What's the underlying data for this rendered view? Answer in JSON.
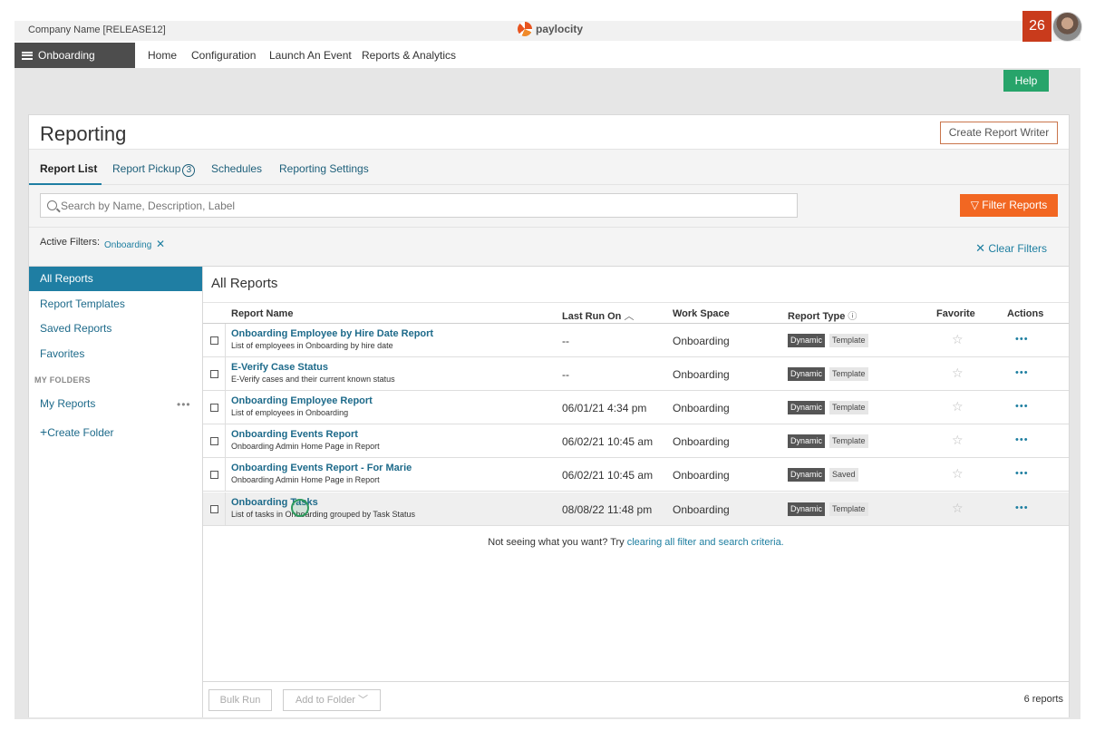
{
  "header": {
    "company": "Company Name [RELEASE12]",
    "brand": "paylocity",
    "notification_count": "26"
  },
  "nav": {
    "menu_label": "Onboarding",
    "links": [
      "Home",
      "Configuration",
      "Launch An Event",
      "Reports & Analytics"
    ]
  },
  "help_label": "Help",
  "page": {
    "title": "Reporting",
    "create_button": "Create Report Writer"
  },
  "tabs": [
    {
      "label": "Report List",
      "active": true
    },
    {
      "label": "Report Pickup",
      "badge": "3"
    },
    {
      "label": "Schedules"
    },
    {
      "label": "Reporting Settings"
    }
  ],
  "search": {
    "placeholder": "Search by Name, Description, Label",
    "value": ""
  },
  "filter_button": "Filter Reports",
  "active_filters": {
    "label": "Active Filters:",
    "chip": "Onboarding",
    "clear": "Clear Filters"
  },
  "sidebar": {
    "items": [
      "All Reports",
      "Report Templates",
      "Saved Reports",
      "Favorites"
    ],
    "section": "MY FOLDERS",
    "folders": [
      "My Reports"
    ],
    "create_folder": "Create Folder"
  },
  "content": {
    "title": "All Reports",
    "columns": [
      "Report Name",
      "Last Run On",
      "Work Space",
      "Report Type",
      "Favorite",
      "Actions"
    ],
    "rows": [
      {
        "name": "Onboarding Employee by Hire Date Report",
        "desc": "List of employees in Onboarding by hire date",
        "last_run": "--",
        "workspace": "Onboarding",
        "type1": "Dynamic",
        "type2": "Template"
      },
      {
        "name": "E-Verify Case Status",
        "desc": "E-Verify cases and their current known status",
        "last_run": "--",
        "workspace": "Onboarding",
        "type1": "Dynamic",
        "type2": "Template"
      },
      {
        "name": "Onboarding Employee Report",
        "desc": "List of employees in Onboarding",
        "last_run": "06/01/21 4:34 pm",
        "workspace": "Onboarding",
        "type1": "Dynamic",
        "type2": "Template"
      },
      {
        "name": "Onboarding Events Report",
        "desc": "Onboarding Admin Home Page in Report",
        "last_run": "06/02/21 10:45 am",
        "workspace": "Onboarding",
        "type1": "Dynamic",
        "type2": "Template"
      },
      {
        "name": "Onboarding Events Report - For Marie",
        "desc": "Onboarding Admin Home Page in Report",
        "last_run": "06/02/21 10:45 am",
        "workspace": "Onboarding",
        "type1": "Dynamic",
        "type2": "Saved"
      },
      {
        "name": "Onboarding Tasks",
        "desc": "List of tasks in Onboarding grouped by Task Status",
        "last_run": "08/08/22 11:48 pm",
        "workspace": "Onboarding",
        "type1": "Dynamic",
        "type2": "Template"
      }
    ],
    "hint_text": "Not seeing what you want? Try ",
    "hint_link": "clearing all filter and search criteria."
  },
  "footer": {
    "bulk_run": "Bulk Run",
    "add_to_folder": "Add to Folder",
    "count": "6 reports"
  },
  "colors": {
    "accent": "#1f7ea3",
    "filter_button": "#f26722",
    "help_button": "#27a46a",
    "notification": "#c93b1c"
  }
}
